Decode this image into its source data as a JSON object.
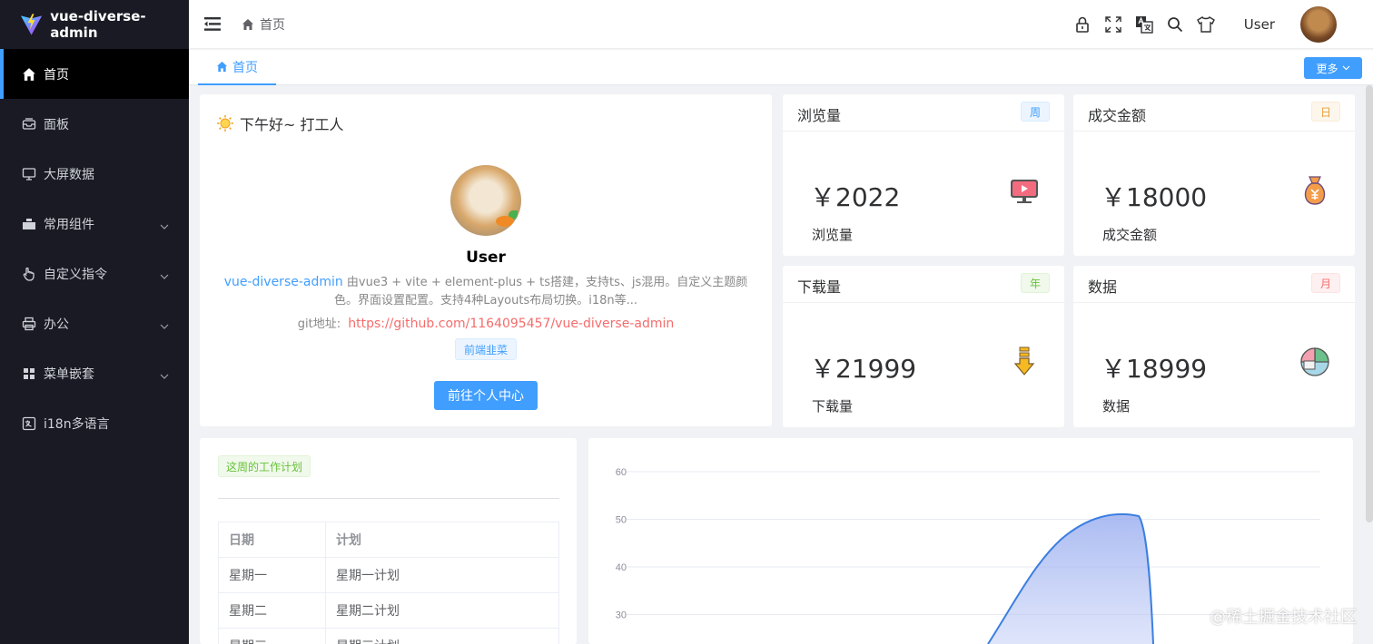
{
  "app": {
    "logo_text": "vue-diverse-admin"
  },
  "sidebar": {
    "items": [
      {
        "label": "首页",
        "icon": "home-icon",
        "active": true,
        "has_children": false
      },
      {
        "label": "面板",
        "icon": "dashboard-icon",
        "active": false,
        "has_children": false
      },
      {
        "label": "大屏数据",
        "icon": "monitor-icon",
        "active": false,
        "has_children": false
      },
      {
        "label": "常用组件",
        "icon": "components-icon",
        "active": false,
        "has_children": true
      },
      {
        "label": "自定义指令",
        "icon": "pointer-icon",
        "active": false,
        "has_children": true
      },
      {
        "label": "办公",
        "icon": "printer-icon",
        "active": false,
        "has_children": true
      },
      {
        "label": "菜单嵌套",
        "icon": "grid-icon",
        "active": false,
        "has_children": true
      },
      {
        "label": "i18n多语言",
        "icon": "translate-icon",
        "active": false,
        "has_children": false
      }
    ]
  },
  "header": {
    "breadcrumb": "首页",
    "user_name": "User"
  },
  "tabs": {
    "home": "首页",
    "more": "更多"
  },
  "welcome": {
    "greeting": "下午好~ 打工人",
    "user": "User",
    "project_name": "vue-diverse-admin",
    "description": "由vue3 + vite + element-plus + ts搭建，支持ts、js混用。自定义主题颜色。界面设置配置。支持4种Layouts布局切换。i18n等...",
    "git_label": "git地址:",
    "git_url": "https://github.com/1164095457/vue-diverse-admin",
    "tag": "前端韭菜",
    "button": "前往个人中心"
  },
  "stats": [
    {
      "title": "浏览量",
      "tag": "周",
      "value": "￥2022",
      "sub": "浏览量",
      "icon": "tv-icon",
      "tag_color": "#409eff"
    },
    {
      "title": "成交金额",
      "tag": "日",
      "value": "￥18000",
      "sub": "成交金额",
      "icon": "money-bag-icon",
      "tag_color": "#e6a23c"
    },
    {
      "title": "下载量",
      "tag": "年",
      "value": "￥21999",
      "sub": "下载量",
      "icon": "download-icon",
      "tag_color": "#67c23a"
    },
    {
      "title": "数据",
      "tag": "月",
      "value": "￥18999",
      "sub": "数据",
      "icon": "pie-chart-icon",
      "tag_color": "#f56c6c"
    }
  ],
  "plan": {
    "tag": "这周的工作计划",
    "headers": [
      "日期",
      "计划"
    ],
    "rows": [
      [
        "星期一",
        "星期一计划"
      ],
      [
        "星期二",
        "星期二计划"
      ],
      [
        "星期三",
        "星期三计划"
      ]
    ]
  },
  "chart_data": {
    "type": "area",
    "y_ticks": [
      60,
      50,
      40,
      30
    ],
    "ylim": [
      0,
      60
    ],
    "color": "#3b7fe0"
  },
  "watermark": "@稀土掘金技术社区"
}
